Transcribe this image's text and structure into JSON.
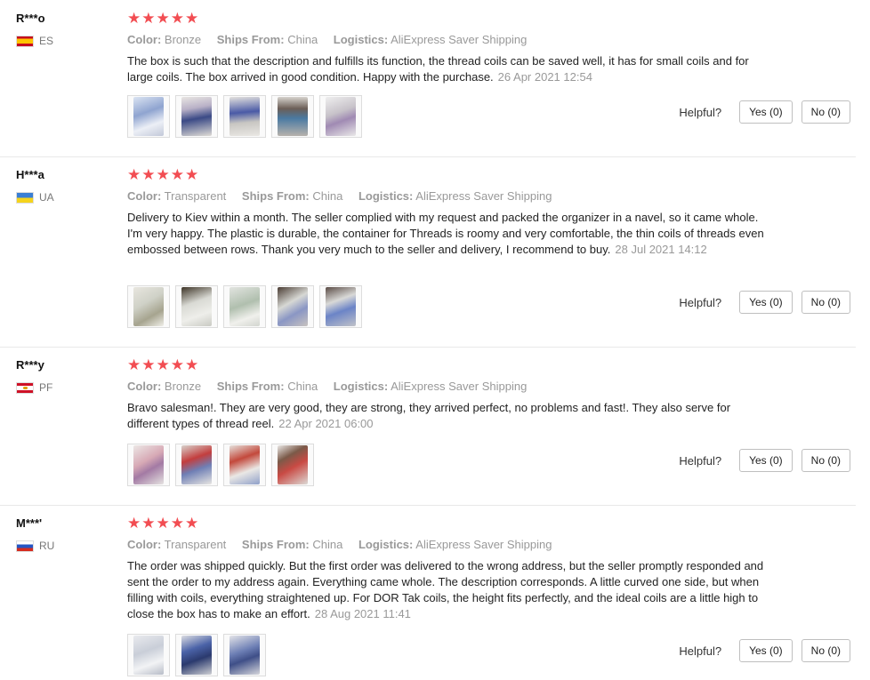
{
  "reviews": [
    {
      "user": "R***o",
      "country": "ES",
      "stars": "★★★★★",
      "color_label": "Color:",
      "color_value": "Bronze",
      "ships_label": "Ships From:",
      "ships_value": "China",
      "logistics_label": "Logistics:",
      "logistics_value": "AliExpress Saver Shipping",
      "text": "The box is such that the description and fulfills its function, the thread coils can be saved well, it has for small coils and for large coils. The box arrived in good condition. Happy with the purchase.",
      "date": "26 Apr 2021 12:54",
      "helpful_label": "Helpful?",
      "yes_label": "Yes (0)",
      "no_label": "No (0)"
    },
    {
      "user": "H***a",
      "country": "UA",
      "stars": "★★★★★",
      "color_label": "Color:",
      "color_value": "Transparent",
      "ships_label": "Ships From:",
      "ships_value": "China",
      "logistics_label": "Logistics:",
      "logistics_value": "AliExpress Saver Shipping",
      "text": "Delivery to Kiev within a month. The seller complied with my request and packed the organizer in a navel, so it came whole. I'm very happy. The plastic is durable, the container for Threads is roomy and very comfortable, the thin coils of threads even embossed between rows. Thank you very much to the seller and delivery, I recommend to buy.",
      "date": "28 Jul 2021 14:12",
      "helpful_label": "Helpful?",
      "yes_label": "Yes (0)",
      "no_label": "No (0)"
    },
    {
      "user": "R***y",
      "country": "PF",
      "stars": "★★★★★",
      "color_label": "Color:",
      "color_value": "Bronze",
      "ships_label": "Ships From:",
      "ships_value": "China",
      "logistics_label": "Logistics:",
      "logistics_value": "AliExpress Saver Shipping",
      "text": "Bravo salesman!. They are very good, they are strong, they arrived perfect, no problems and fast!. They also serve for different types of thread reel.",
      "date": "22 Apr 2021 06:00",
      "helpful_label": "Helpful?",
      "yes_label": "Yes (0)",
      "no_label": "No (0)"
    },
    {
      "user": "M***'",
      "country": "RU",
      "stars": "★★★★★",
      "color_label": "Color:",
      "color_value": "Transparent",
      "ships_label": "Ships From:",
      "ships_value": "China",
      "logistics_label": "Logistics:",
      "logistics_value": "AliExpress Saver Shipping",
      "text": "The order was shipped quickly. But the first order was delivered to the wrong address, but the seller promptly responded and sent the order to my address again. Everything came whole. The description corresponds. A little curved one side, but when filling with coils, everything straightened up. For DOR Tak coils, the height fits perfectly, and the ideal coils are a little high to close the box has to make an effort.",
      "date": "28 Aug 2021 11:41",
      "helpful_label": "Helpful?",
      "yes_label": "Yes (0)",
      "no_label": "No (0)"
    }
  ]
}
